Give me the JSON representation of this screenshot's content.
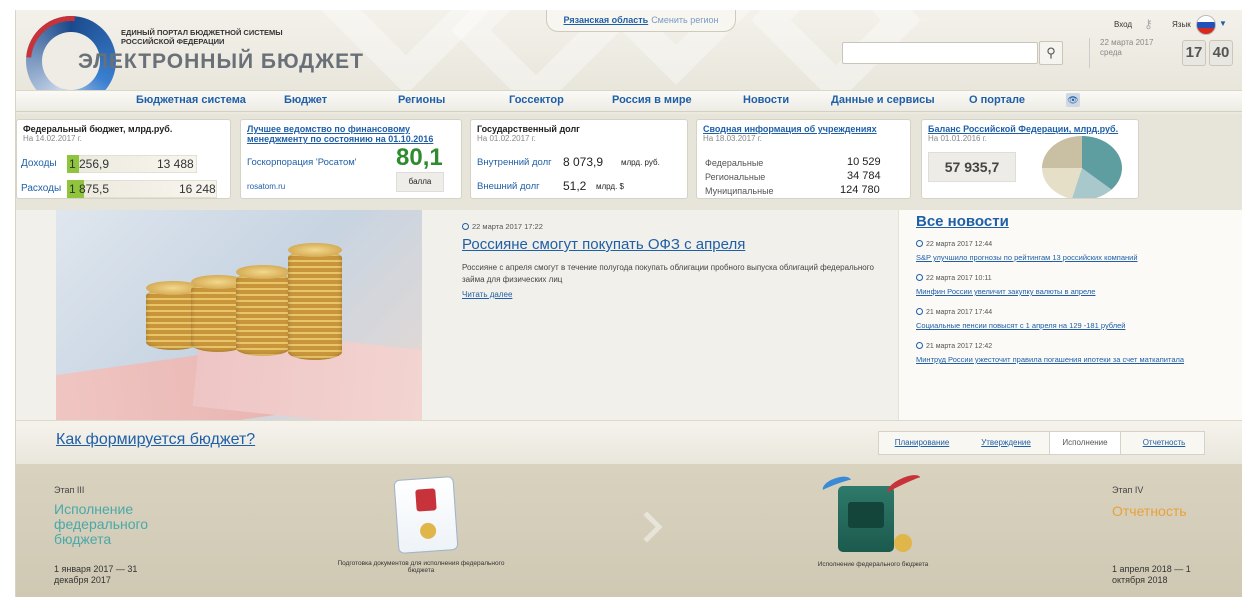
{
  "header": {
    "logo_line1": "ЕДИНЫЙ ПОРТАЛ БЮДЖЕТНОЙ СИСТЕМЫ",
    "logo_line2": "РОССИЙСКОЙ ФЕДЕРАЦИИ",
    "logo_title": "ЭЛЕКТРОННЫЙ БЮДЖЕТ",
    "region": "Рязанская область",
    "change_region": "Сменить регион",
    "login": "Вход",
    "language": "Язык",
    "search_placeholder": "",
    "date_line1": "22 марта 2017",
    "date_line2": "среда",
    "clock_hours": "17",
    "clock_minutes": "40"
  },
  "nav": [
    "Бюджетная система",
    "Бюджет",
    "Регионы",
    "Госсектор",
    "Россия в мире",
    "Новости",
    "Данные и сервисы",
    "О портале"
  ],
  "widgets": {
    "federal": {
      "title": "Федеральный бюджет, млрд.руб.",
      "subtitle": "На 14.02.2017 г.",
      "income_label": "Доходы",
      "income_value": "1 256,9",
      "income_total": "13 488",
      "income_fraction": 0.093,
      "expense_label": "Расходы",
      "expense_value": "1 875,5",
      "expense_total": "16 248",
      "expense_fraction": 0.115
    },
    "best": {
      "title": "Лучшее ведомство по финансовому менеджменту по состоянию на 01.10.2016",
      "org": "Госкорпорация 'Росатом'",
      "site": "rosatom.ru",
      "score": "80,1",
      "score_unit": "балла"
    },
    "debt": {
      "title": "Государственный долг",
      "subtitle": "На 01.02.2017 г.",
      "internal_label": "Внутренний долг",
      "internal_value": "8 073,9",
      "internal_unit": "млрд. руб.",
      "external_label": "Внешний долг",
      "external_value": "51,2",
      "external_unit": "млрд. $"
    },
    "institutions": {
      "title": "Сводная информация об учреждениях",
      "subtitle": "На 18.03.2017 г.",
      "rows": [
        {
          "label": "Федеральные",
          "value": "10 529"
        },
        {
          "label": "Региональные",
          "value": "34 784"
        },
        {
          "label": "Муниципальные",
          "value": "124 780"
        }
      ]
    },
    "balance": {
      "title": "Баланс Российской Федерации, млрд.руб.",
      "subtitle": "На 01.01.2016 г.",
      "value": "57 935,7"
    }
  },
  "news": {
    "date": "22 марта 2017 17:22",
    "title": "Россияне смогут покупать ОФЗ с апреля",
    "body": "Россияне с апреля смогут в течение полугода покупать облигации пробного выпуска облигаций федерального займа для физических лиц",
    "more": "Читать далее"
  },
  "side_news": {
    "title": "Все новости",
    "items": [
      {
        "date": "22 марта 2017 12:44",
        "text": "S&P улучшило прогнозы по рейтингам 13 российских компаний"
      },
      {
        "date": "22 марта 2017 10:11",
        "text": "Минфин России увеличит закупку валюты в апреле"
      },
      {
        "date": "21 марта 2017 17:44",
        "text": "Социальные пенсии повысят с 1 апреля на 129 -181 рублей"
      },
      {
        "date": "21 марта 2017 12:42",
        "text": "Минтруд России ужесточит правила погашения ипотеки за счет маткапитала"
      }
    ]
  },
  "howto": {
    "title": "Как формируется бюджет?",
    "tabs": [
      "Планирование",
      "Утверждение",
      "Исполнение",
      "Отчетность"
    ],
    "active_tab": "Исполнение"
  },
  "stages": {
    "left_stage": "Этап III",
    "left_name": "Исполнение федерального бюджета",
    "left_date": "1 января 2017 — 31 декабря 2017",
    "left_color": "#4aa8a8",
    "caption1": "Подготовка документов для исполнения федерального бюджета",
    "caption2": "Исполнение федерального бюджета",
    "right_stage": "Этап IV",
    "right_name": "Отчетность",
    "right_date": "1 апреля 2018 — 1 октября 2018",
    "right_color": "#e8a23a"
  },
  "colors": {
    "link": "#1f5fa8",
    "green": "#2e8b2e",
    "bar_fill": "#8fc43d"
  }
}
